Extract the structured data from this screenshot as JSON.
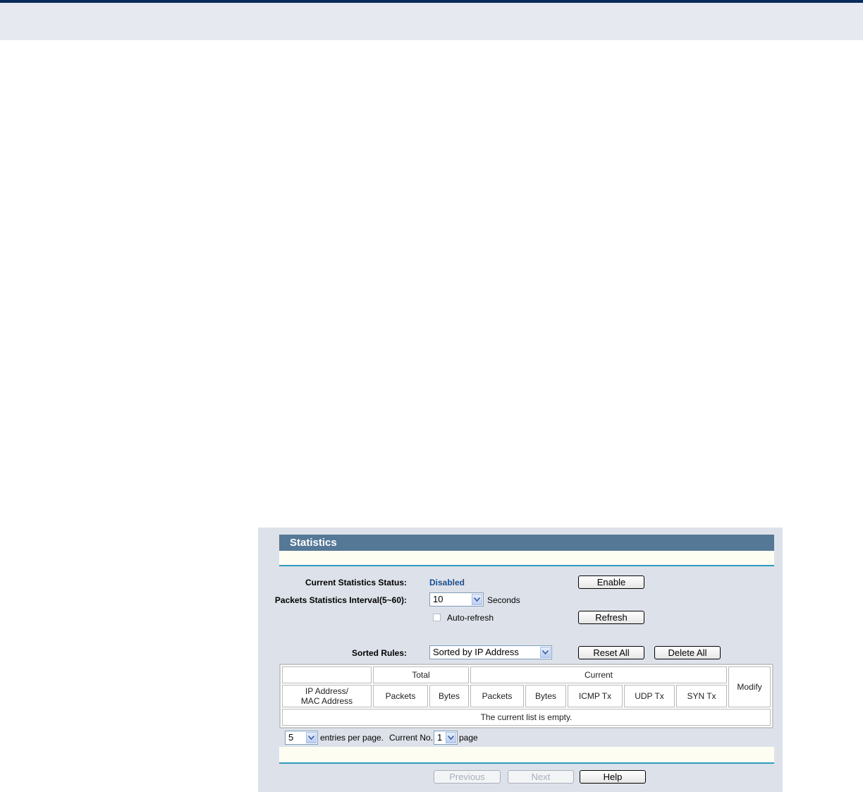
{
  "panel": {
    "title": "Statistics"
  },
  "status": {
    "label": "Current Statistics Status:",
    "value": "Disabled",
    "enable_label": "Enable"
  },
  "interval": {
    "label": "Packets Statistics Interval(5~60):",
    "value": "10",
    "unit": "Seconds"
  },
  "auto_refresh": {
    "label": "Auto-refresh",
    "checked": false
  },
  "refresh_label": "Refresh",
  "sorted": {
    "label": "Sorted Rules:",
    "value": "Sorted by IP Address",
    "reset_all_label": "Reset All",
    "delete_all_label": "Delete All"
  },
  "table": {
    "group_total": "Total",
    "group_current": "Current",
    "modify": "Modify",
    "address_line1": "IP Address/",
    "address_line2": "MAC Address",
    "columns": [
      "Packets",
      "Bytes",
      "Packets",
      "Bytes",
      "ICMP Tx",
      "UDP Tx",
      "SYN Tx"
    ],
    "empty_message": "The current list is empty."
  },
  "paging": {
    "per_page_value": "5",
    "per_page_text": "entries per page.",
    "current_no_label": "Current No.",
    "page_value": "1",
    "page_text": "page"
  },
  "nav": {
    "previous": "Previous",
    "next": "Next",
    "help": "Help"
  },
  "colors": {
    "header_bar": "#557896",
    "status_value": "#1d4d8f",
    "divider": "#2d9bbf"
  }
}
